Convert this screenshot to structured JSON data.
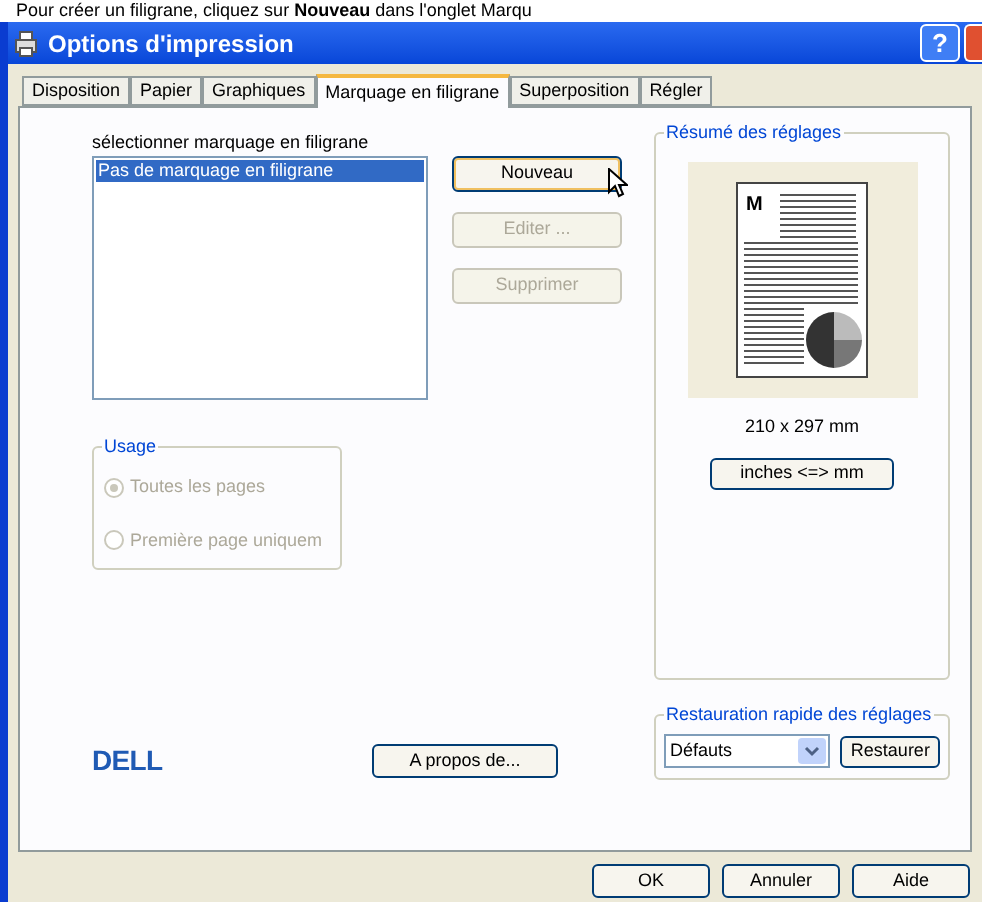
{
  "caption": "Pour créer un filigrane, cliquez sur **Nouveau** dans l'onglet Marqu",
  "window": {
    "title": "Options d'impression",
    "help_button": "?"
  },
  "preview_mark": "M",
  "tabs": [
    {
      "label": "Disposition",
      "selected": false
    },
    {
      "label": "Papier",
      "selected": false
    },
    {
      "label": "Graphiques",
      "selected": false
    },
    {
      "label": "Marquage en filigrane",
      "selected": true
    },
    {
      "label": "Superposition",
      "selected": false
    },
    {
      "label": "Régler",
      "selected": false
    }
  ],
  "watermark_list": {
    "label": "sélectionner marquage en filigrane",
    "items": [
      {
        "label": "Pas de marquage en filigrane",
        "selected": true
      }
    ]
  },
  "actions": [
    {
      "label": "Nouveau",
      "disabled": false
    },
    {
      "label": "Editer ...",
      "disabled": true
    },
    {
      "label": "Supprimer",
      "disabled": true
    }
  ],
  "usage": {
    "title": "Usage",
    "disabled": true,
    "options": [
      {
        "label": "Toutes les pages",
        "selected": true
      },
      {
        "label": "Première page uniquem",
        "selected": false
      }
    ]
  },
  "summary": {
    "title": "Résumé des réglages",
    "paper_size": "210 x 297 mm",
    "units_button": "inches <=> mm"
  },
  "logo": "DELL",
  "about_button": "A propos de...",
  "quick_restore": {
    "title": "Restauration rapide des réglages",
    "value": "Défauts",
    "button": "Restaurer"
  },
  "footer_buttons": [
    "OK",
    "Annuler",
    "Aide"
  ]
}
